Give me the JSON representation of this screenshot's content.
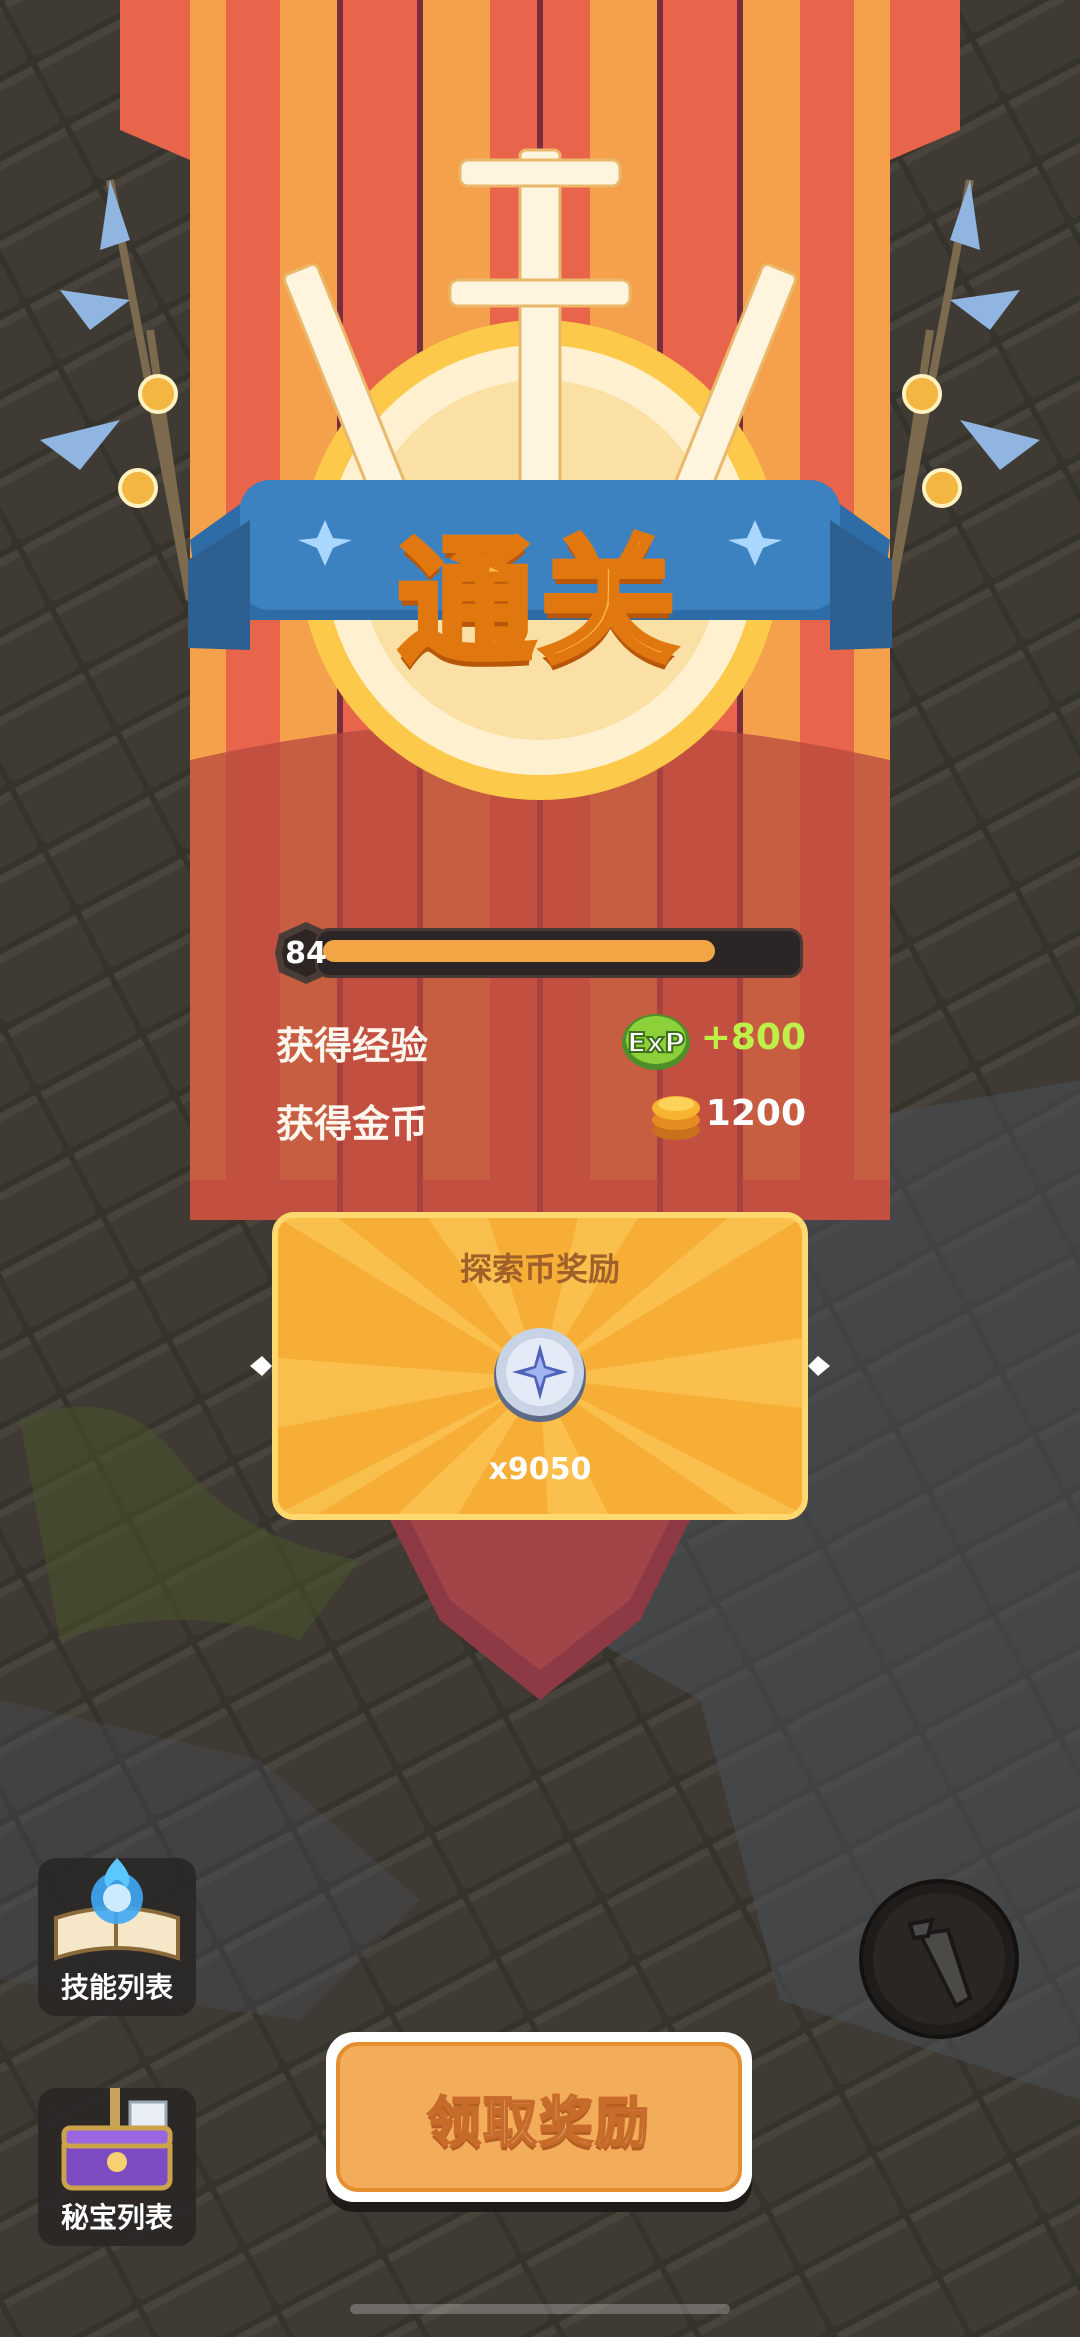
{
  "result": {
    "title": "通关",
    "level": "84",
    "level_progress": 0.83
  },
  "rewards": {
    "exp_label": "获得经验",
    "exp_icon": "exp-icon",
    "exp_value": "+800",
    "gold_label": "获得金币",
    "gold_icon": "gold-coin-icon",
    "gold_value": "1200"
  },
  "exploration": {
    "title": "探索币奖励",
    "icon": "compass-coin-icon",
    "amount": "x9050"
  },
  "side_menu": {
    "skills_label": "技能列表",
    "skills_icon": "spellbook-icon",
    "treasure_label": "秘宝列表",
    "treasure_icon": "treasure-chest-icon"
  },
  "claim_button": {
    "label": "领取奖励"
  },
  "action_icon": "sword-skill-icon",
  "colors": {
    "banner_red": "#e8644a",
    "banner_orange": "#f5a04b",
    "ribbon_blue": "#3c82c0",
    "exp_green": "#bff04a",
    "gold_text": "#ffffff",
    "card_yellow": "#f6ae37"
  }
}
